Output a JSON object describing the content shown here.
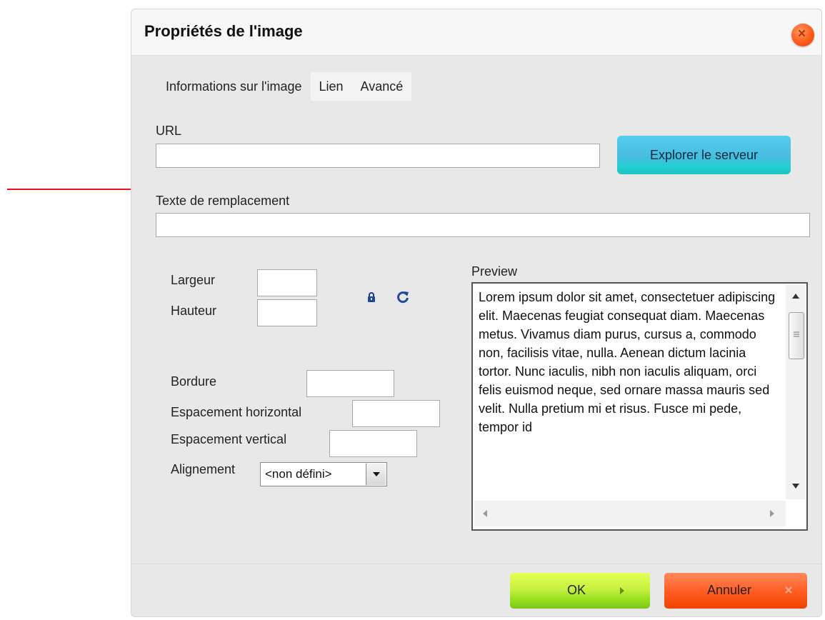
{
  "dialog": {
    "title": "Propriétés de l'image",
    "close_icon": "close-icon",
    "tabs": [
      {
        "label": "Informations sur l'image",
        "active": true
      },
      {
        "label": "Lien",
        "active": false
      },
      {
        "label": "Avancé",
        "active": false
      }
    ]
  },
  "form": {
    "url_label": "URL",
    "url_value": "",
    "browse_label": "Explorer le serveur",
    "alt_label": "Texte de remplacement",
    "alt_value": "",
    "width_label": "Largeur",
    "height_label": "Hauteur",
    "width_value": "",
    "height_value": "",
    "lock_icon": "lock-icon",
    "reset_icon": "reset-size-icon",
    "border_label": "Bordure",
    "border_value": "",
    "hspace_label": "Espacement horizontal",
    "hspace_value": "",
    "vspace_label": "Espacement vertical",
    "vspace_value": "",
    "align_label": "Alignement",
    "align_value": "<non défini>"
  },
  "preview": {
    "label": "Preview",
    "text": "Lorem ipsum dolor sit amet, consectetuer adipiscing elit. Maecenas feugiat consequat diam. Maecenas metus. Vivamus diam purus, cursus a, commodo non, facilisis vitae, nulla. Aenean dictum lacinia tortor. Nunc iaculis, nibh non iaculis aliquam, orci felis euismod neque, sed ornare massa mauris sed velit. Nulla pretium mi et risus. Fusce mi pede, tempor id"
  },
  "footer": {
    "ok_label": "OK",
    "cancel_label": "Annuler"
  },
  "colors": {
    "annotation_arrow": "#e8101a",
    "browse_button": "#48bde0",
    "ok_button": "#c8f040",
    "cancel_button": "#ff5a20",
    "close_button": "#ff5a1a"
  }
}
